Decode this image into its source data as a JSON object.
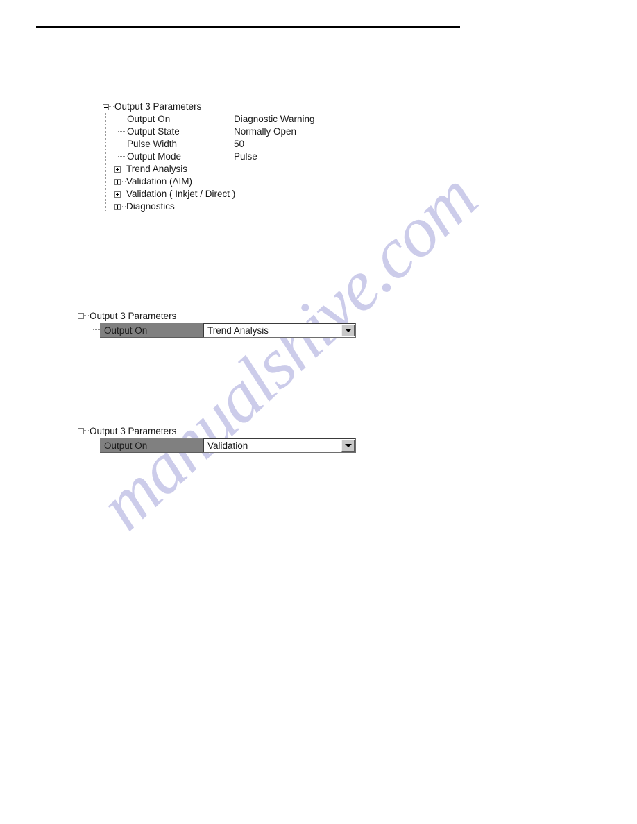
{
  "page": {
    "watermark_text": "manualshive.com",
    "watermark_color": "#ccccea",
    "background": "#ffffff",
    "rule_color": "#000000"
  },
  "tree_params": {
    "root_label": "Output 3 Parameters",
    "root_expander": "minus-box-icon",
    "leaves": [
      {
        "label": "Output On",
        "value": "Diagnostic Warning"
      },
      {
        "label": "Output State",
        "value": "Normally Open"
      },
      {
        "label": "Pulse Width",
        "value": "50"
      },
      {
        "label": "Output Mode",
        "value": "Pulse"
      }
    ],
    "collapsed_nodes": [
      {
        "label": "Trend Analysis",
        "expander": "plus-box-icon"
      },
      {
        "label": "Validation (AIM)",
        "expander": "plus-box-icon"
      },
      {
        "label": "Validation ( Inkjet / Direct )",
        "expander": "plus-box-icon"
      },
      {
        "label": "Diagnostics",
        "expander": "plus-box-icon"
      }
    ]
  },
  "combo_section_1": {
    "root_label": "Output 3 Parameters",
    "root_expander": "minus-box-icon",
    "property_label": "Output On",
    "selected_value": "Trend Analysis",
    "dropdown_icon": "chevron-down-icon",
    "selection_background": "#808080"
  },
  "combo_section_2": {
    "root_label": "Output 3 Parameters",
    "root_expander": "minus-box-icon",
    "property_label": "Output On",
    "selected_value": "Validation",
    "dropdown_icon": "chevron-down-icon",
    "selection_background": "#808080"
  }
}
